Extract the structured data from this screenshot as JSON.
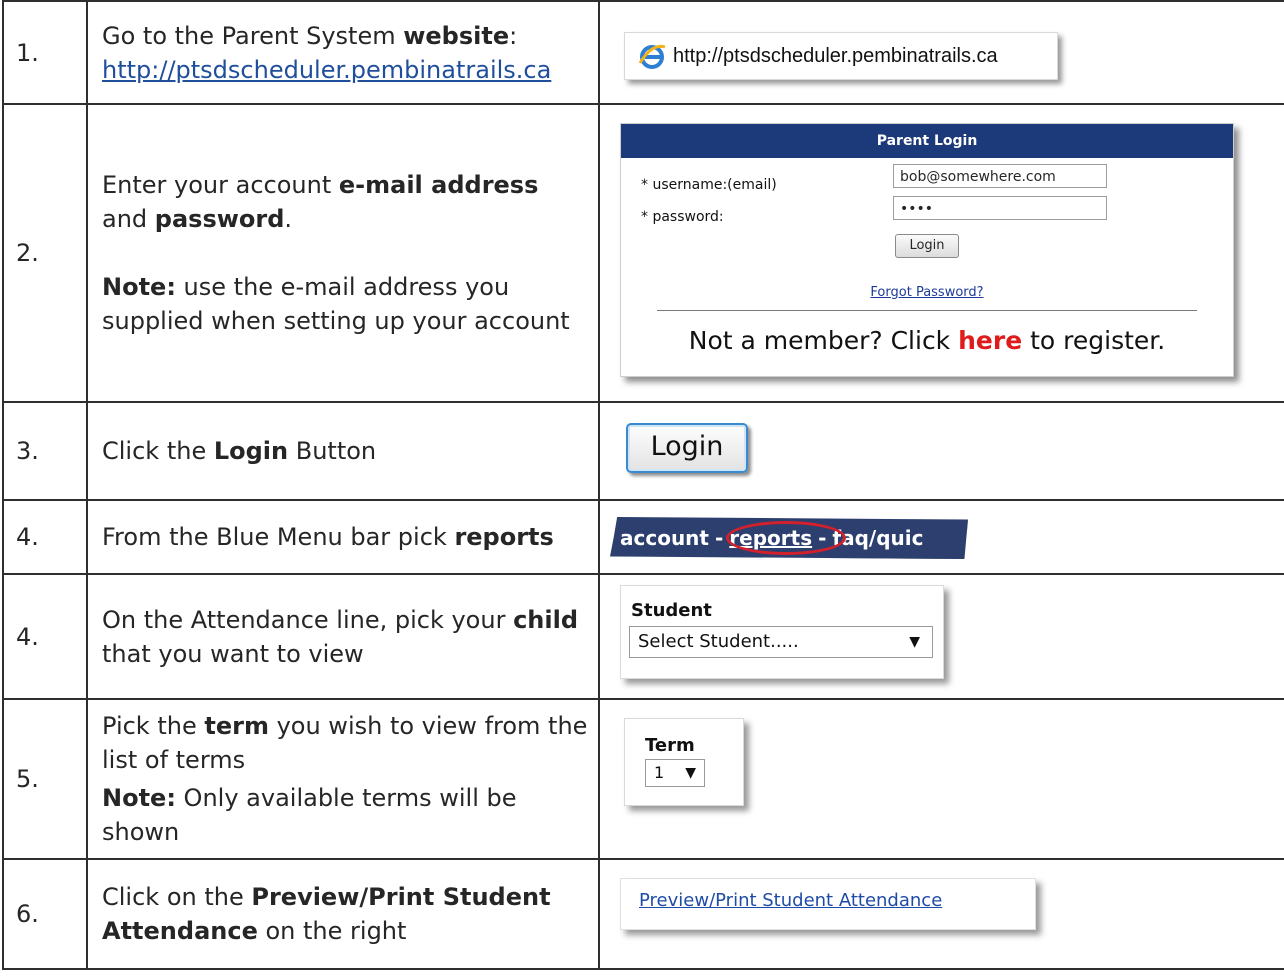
{
  "steps": [
    {
      "number": "1.",
      "text_pre": "Go to the Parent System ",
      "text_bold": "website",
      "text_post": ":",
      "link": "http://ptsdscheduler.pembinatrails.ca",
      "screenshot": {
        "url": "http://ptsdscheduler.pembinatrails.ca",
        "icon": "internet-explorer-icon"
      }
    },
    {
      "number": "2.",
      "text_pre": "Enter your account ",
      "text_bold1": "e-mail address",
      "text_mid": " and ",
      "text_bold2": "password",
      "text_post": ".",
      "note_label": "Note:",
      "note_text": " use the e-mail address you supplied when setting up your account",
      "screenshot": {
        "header": "Parent Login",
        "username_label": "* username:(email)",
        "username_value": "bob@somewhere.com",
        "password_label": "* password:",
        "password_value": "••••",
        "login_button": "Login",
        "forgot_link": "Forgot Password?",
        "member_pre": "Not a member? Click ",
        "member_link": "here",
        "member_post": " to register."
      }
    },
    {
      "number": "3.",
      "text_pre": "Click the ",
      "text_bold": "Login",
      "text_post": " Button",
      "screenshot": {
        "button": "Login"
      }
    },
    {
      "number": "4.",
      "text_pre": "From the Blue Menu bar pick ",
      "text_bold": "reports",
      "screenshot": {
        "item1": "account",
        "sep": "-",
        "item2": "reports",
        "item3": "faq/quic"
      }
    },
    {
      "number": "4.",
      "text_pre": "On the Attendance line, pick your ",
      "text_bold": "child",
      "text_post": " that you want to view",
      "screenshot": {
        "label": "Student",
        "select_value": "Select Student....."
      }
    },
    {
      "number": "5.",
      "text_pre": "Pick the ",
      "text_bold": "term",
      "text_post": " you wish to view from the list of terms",
      "note_label": "Note:",
      "note_text": " Only available terms will be shown",
      "screenshot": {
        "label": "Term",
        "select_value": "1"
      }
    },
    {
      "number": "6.",
      "text_pre": "Click on the ",
      "text_bold": "Preview/Print Student Attendance",
      "text_post": " on the right",
      "screenshot": {
        "link": "Preview/Print Student Attendance "
      }
    }
  ],
  "colors": {
    "login_header": "#1c3a7a",
    "menu_bar": "#2c3f6e",
    "link_blue": "#1f4f9c",
    "register_red": "#e01b1b",
    "circle_red": "#d3202d"
  }
}
